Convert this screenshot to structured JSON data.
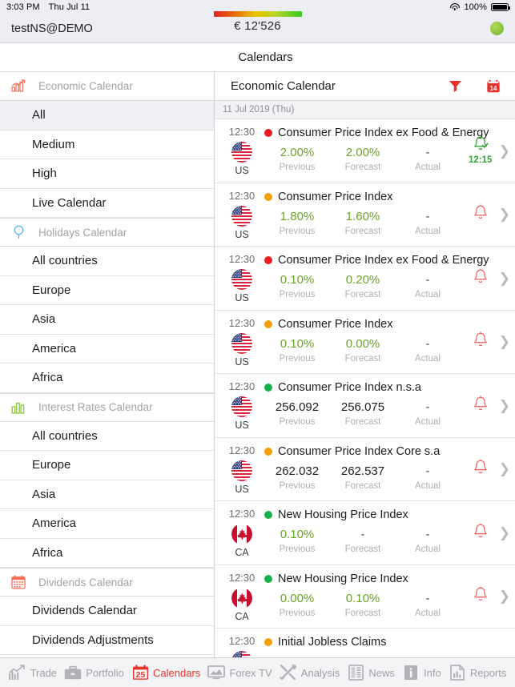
{
  "status_bar": {
    "time": "3:03 PM",
    "date": "Thu Jul 11",
    "wifi_icon": "wifi-icon",
    "battery_percent": "100%",
    "battery_icon": "battery-icon"
  },
  "account_bar": {
    "account_name": "testNS@DEMO",
    "balance": "€ 12'526",
    "gauge_icon": "balance-gauge",
    "connection_status_icon": "connection-status-dot",
    "connection_color": "#8cc63f"
  },
  "screen_title": "Calendars",
  "sidebar": {
    "groups": [
      {
        "icon": "economic-calendar-icon",
        "icon_color": "#f4705a",
        "label": "Economic Calendar",
        "items": [
          {
            "label": "All",
            "selected": true
          },
          {
            "label": "Medium",
            "selected": false
          },
          {
            "label": "High",
            "selected": false
          },
          {
            "label": "Live Calendar",
            "selected": false
          }
        ]
      },
      {
        "icon": "holidays-calendar-icon",
        "icon_color": "#5bb8e8",
        "label": "Holidays Calendar",
        "items": [
          {
            "label": "All countries",
            "selected": false
          },
          {
            "label": "Europe",
            "selected": false
          },
          {
            "label": "Asia",
            "selected": false
          },
          {
            "label": "America",
            "selected": false
          },
          {
            "label": "Africa",
            "selected": false
          }
        ]
      },
      {
        "icon": "interest-rates-calendar-icon",
        "icon_color": "#8cc63f",
        "label": "Interest Rates Calendar",
        "items": [
          {
            "label": "All countries",
            "selected": false
          },
          {
            "label": "Europe",
            "selected": false
          },
          {
            "label": "Asia",
            "selected": false
          },
          {
            "label": "America",
            "selected": false
          },
          {
            "label": "Africa",
            "selected": false
          }
        ]
      },
      {
        "icon": "dividends-calendar-icon",
        "icon_color": "#f4705a",
        "label": "Dividends Calendar",
        "items": [
          {
            "label": "Dividends Calendar",
            "selected": false
          },
          {
            "label": "Dividends Adjustments",
            "selected": false
          }
        ]
      }
    ]
  },
  "content": {
    "title": "Economic Calendar",
    "filter_icon": "filter-icon",
    "calendar_icon": "calendar-icon",
    "calendar_icon_day": "14",
    "accent_color": "#e8312a",
    "date_header": "11 Jul 2019 (Thu)",
    "column_labels": {
      "previous": "Previous",
      "forecast": "Forecast",
      "actual": "Actual"
    },
    "events": [
      {
        "time": "12:30",
        "country": "US",
        "flag": "us-flag",
        "impact": "high",
        "impact_color": "#ee1c25",
        "title": "Consumer Price Index ex Food & Energy",
        "previous": "2.00%",
        "previous_style": "green",
        "forecast": "2.00%",
        "forecast_style": "green",
        "actual": "-",
        "actual_style": "dash",
        "bell_icon": "bell-checked-icon",
        "bell_color": "#35a535",
        "alert_time": "12:15",
        "chevron_icon": "chevron-right-icon"
      },
      {
        "time": "12:30",
        "country": "US",
        "flag": "us-flag",
        "impact": "medium",
        "impact_color": "#f5a000",
        "title": "Consumer Price Index",
        "previous": "1.80%",
        "previous_style": "green",
        "forecast": "1.60%",
        "forecast_style": "green",
        "actual": "-",
        "actual_style": "dash",
        "bell_icon": "bell-icon",
        "bell_color": "#ef6a6a",
        "alert_time": "",
        "chevron_icon": "chevron-right-icon"
      },
      {
        "time": "12:30",
        "country": "US",
        "flag": "us-flag",
        "impact": "high",
        "impact_color": "#ee1c25",
        "title": "Consumer Price Index ex Food & Energy",
        "previous": "0.10%",
        "previous_style": "green",
        "forecast": "0.20%",
        "forecast_style": "green",
        "actual": "-",
        "actual_style": "dash",
        "bell_icon": "bell-icon",
        "bell_color": "#ef6a6a",
        "alert_time": "",
        "chevron_icon": "chevron-right-icon"
      },
      {
        "time": "12:30",
        "country": "US",
        "flag": "us-flag",
        "impact": "medium",
        "impact_color": "#f5a000",
        "title": "Consumer Price Index",
        "previous": "0.10%",
        "previous_style": "green",
        "forecast": "0.00%",
        "forecast_style": "green",
        "actual": "-",
        "actual_style": "dash",
        "bell_icon": "bell-icon",
        "bell_color": "#ef6a6a",
        "alert_time": "",
        "chevron_icon": "chevron-right-icon"
      },
      {
        "time": "12:30",
        "country": "US",
        "flag": "us-flag",
        "impact": "low",
        "impact_color": "#13b14c",
        "title": "Consumer Price Index n.s.a",
        "previous": "256.092",
        "previous_style": "dark",
        "forecast": "256.075",
        "forecast_style": "dark",
        "actual": "-",
        "actual_style": "dash",
        "bell_icon": "bell-icon",
        "bell_color": "#ef6a6a",
        "alert_time": "",
        "chevron_icon": "chevron-right-icon"
      },
      {
        "time": "12:30",
        "country": "US",
        "flag": "us-flag",
        "impact": "medium",
        "impact_color": "#f5a000",
        "title": "Consumer Price Index Core s.a",
        "previous": "262.032",
        "previous_style": "dark",
        "forecast": "262.537",
        "forecast_style": "dark",
        "actual": "-",
        "actual_style": "dash",
        "bell_icon": "bell-icon",
        "bell_color": "#ef6a6a",
        "alert_time": "",
        "chevron_icon": "chevron-right-icon"
      },
      {
        "time": "12:30",
        "country": "CA",
        "flag": "ca-flag",
        "impact": "low",
        "impact_color": "#13b14c",
        "title": "New Housing Price Index",
        "previous": "0.10%",
        "previous_style": "green",
        "forecast": "-",
        "forecast_style": "dash",
        "actual": "-",
        "actual_style": "dash",
        "bell_icon": "bell-icon",
        "bell_color": "#ef6a6a",
        "alert_time": "",
        "chevron_icon": "chevron-right-icon"
      },
      {
        "time": "12:30",
        "country": "CA",
        "flag": "ca-flag",
        "impact": "low",
        "impact_color": "#13b14c",
        "title": "New Housing Price Index",
        "previous": "0.00%",
        "previous_style": "green",
        "forecast": "0.10%",
        "forecast_style": "green",
        "actual": "-",
        "actual_style": "dash",
        "bell_icon": "bell-icon",
        "bell_color": "#ef6a6a",
        "alert_time": "",
        "chevron_icon": "chevron-right-icon"
      },
      {
        "time": "12:30",
        "country": "US",
        "flag": "us-flag",
        "impact": "medium",
        "impact_color": "#f5a000",
        "title": "Initial Jobless Claims",
        "previous": "",
        "previous_style": "dark",
        "forecast": "",
        "forecast_style": "dark",
        "actual": "",
        "actual_style": "dash",
        "bell_icon": "bell-icon",
        "bell_color": "#ef6a6a",
        "alert_time": "",
        "chevron_icon": "chevron-right-icon"
      }
    ]
  },
  "tabbar": {
    "tabs": [
      {
        "label": "Trade",
        "icon": "trade-chart-icon",
        "active": false
      },
      {
        "label": "Portfolio",
        "icon": "briefcase-icon",
        "active": false
      },
      {
        "label": "Calendars",
        "icon": "calendar-25-icon",
        "active": true
      },
      {
        "label": "Forex TV",
        "icon": "tv-monitor-icon",
        "active": false
      },
      {
        "label": "Analysis",
        "icon": "tools-icon",
        "active": false
      },
      {
        "label": "News",
        "icon": "newspaper-icon",
        "active": false
      },
      {
        "label": "Info",
        "icon": "info-icon",
        "active": false
      },
      {
        "label": "Reports",
        "icon": "reports-bar-icon",
        "active": false
      }
    ]
  }
}
